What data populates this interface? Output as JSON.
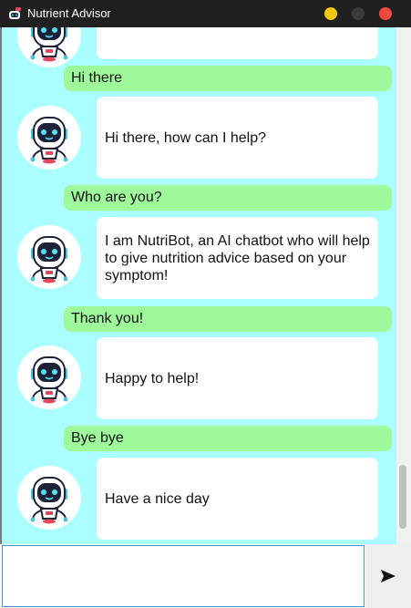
{
  "window": {
    "title": "Nutrient Advisor",
    "controls": {
      "minimize_color": "#f2c80f",
      "maximize_color": "#3a3a3a",
      "close_color": "#f04a3f"
    }
  },
  "colors": {
    "chat_background": "#abfeff",
    "user_bubble": "#9ef99a",
    "bot_bubble": "#ffffff"
  },
  "messages": [
    {
      "role": "bot",
      "text": ""
    },
    {
      "role": "user",
      "text": "Hi there"
    },
    {
      "role": "bot",
      "text": "Hi there, how can I help?"
    },
    {
      "role": "user",
      "text": "Who are you?"
    },
    {
      "role": "bot",
      "text": "I am NutriBot, an AI chatbot who will help to give nutrition advice based on your symptom!"
    },
    {
      "role": "user",
      "text": "Thank you!"
    },
    {
      "role": "bot",
      "text": "Happy to help!"
    },
    {
      "role": "user",
      "text": "Bye bye"
    },
    {
      "role": "bot",
      "text": "Have a nice day"
    }
  ],
  "composer": {
    "value": "",
    "send_icon": "send-icon"
  }
}
